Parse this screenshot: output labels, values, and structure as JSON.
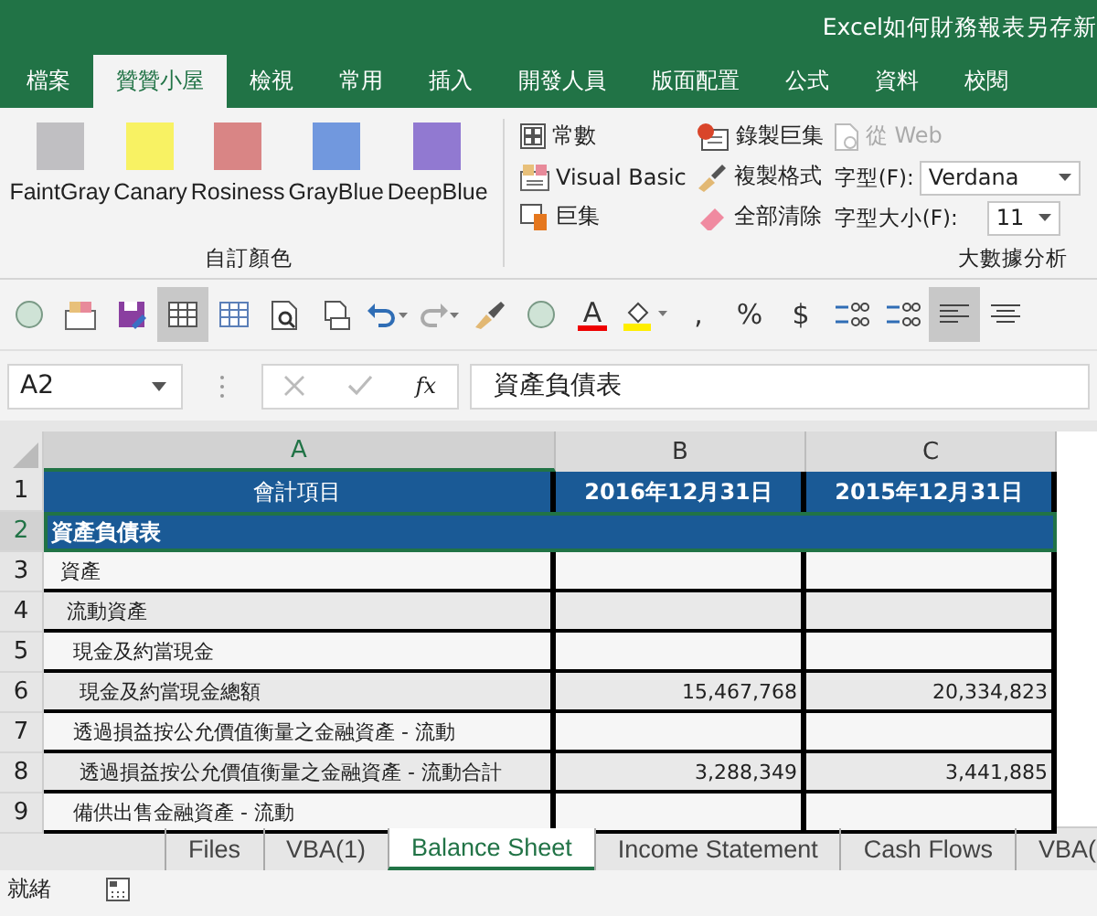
{
  "window": {
    "title": "Excel如何財務報表另存新"
  },
  "menu_tabs": [
    {
      "label": "檔案",
      "selected": false
    },
    {
      "label": "贊贊小屋",
      "selected": true
    },
    {
      "label": "檢視",
      "selected": false
    },
    {
      "label": "常用",
      "selected": false
    },
    {
      "label": "插入",
      "selected": false
    },
    {
      "label": "開發人員",
      "selected": false
    },
    {
      "label": "版面配置",
      "selected": false
    },
    {
      "label": "公式",
      "selected": false
    },
    {
      "label": "資料",
      "selected": false
    },
    {
      "label": "校閱",
      "selected": false
    }
  ],
  "ribbon": {
    "color_group": {
      "label": "自訂顏色",
      "swatches": [
        {
          "name": "FaintGray",
          "color": "#c0bfc2"
        },
        {
          "name": "Canary",
          "color": "#f8f263"
        },
        {
          "name": "Rosiness",
          "color": "#d98585"
        },
        {
          "name": "GrayBlue",
          "color": "#7198de"
        },
        {
          "name": "DeepBlue",
          "color": "#9179d1"
        }
      ]
    },
    "dev_group": {
      "label": "大數據分析",
      "buttons": [
        {
          "kind": "constants",
          "label": "常數",
          "disabled": false
        },
        {
          "kind": "vb",
          "label": "Visual Basic",
          "disabled": false
        },
        {
          "kind": "macro",
          "label": "巨集",
          "disabled": false
        },
        {
          "kind": "record",
          "label": "錄製巨集",
          "disabled": false
        },
        {
          "kind": "brush",
          "label": "複製格式",
          "disabled": false
        },
        {
          "kind": "eraser",
          "label": "全部清除",
          "disabled": false
        },
        {
          "kind": "web",
          "label": "從 Web",
          "disabled": true
        }
      ],
      "font": {
        "label": "字型(F):",
        "value": "Verdana"
      },
      "font_size": {
        "label": "字型大小(F):",
        "value": "11"
      }
    }
  },
  "quick_toolbar": [
    {
      "kind": "circle",
      "selected": false
    },
    {
      "kind": "paste",
      "selected": false
    },
    {
      "kind": "save",
      "selected": false
    },
    {
      "kind": "grid",
      "selected": true
    },
    {
      "kind": "grid2",
      "selected": false
    },
    {
      "kind": "preview",
      "selected": false
    },
    {
      "kind": "print",
      "selected": false
    },
    {
      "kind": "undo",
      "selected": false
    },
    {
      "kind": "redo",
      "selected": false
    },
    {
      "kind": "brush",
      "selected": false
    },
    {
      "kind": "circle",
      "selected": false
    },
    {
      "kind": "fontcolor",
      "label": "A",
      "selected": false
    },
    {
      "kind": "fill",
      "selected": false
    },
    {
      "kind": "glyph",
      "label": ",",
      "selected": false
    },
    {
      "kind": "glyph",
      "label": "%",
      "selected": false
    },
    {
      "kind": "glyph",
      "label": "$",
      "selected": false
    },
    {
      "kind": "incdec",
      "selected": false
    },
    {
      "kind": "decdec",
      "selected": false
    },
    {
      "kind": "alignleft",
      "selected": true
    },
    {
      "kind": "center",
      "selected": false
    }
  ],
  "formula_bar": {
    "name_box": "A2",
    "fx": "fx",
    "value": "資產負債表"
  },
  "columns": [
    {
      "label": "A",
      "selected": true
    },
    {
      "label": "B",
      "selected": false
    },
    {
      "label": "C",
      "selected": false
    }
  ],
  "rows": [
    {
      "number": "1",
      "kind": "header",
      "selected": false,
      "cells": [
        "會計項目",
        "2016年12月31日",
        "2015年12月31日"
      ]
    },
    {
      "number": "2",
      "kind": "title",
      "selected": true,
      "cells": [
        "資產負債表"
      ]
    },
    {
      "number": "3",
      "kind": "item",
      "selected": false,
      "cells": [
        "  資產",
        "",
        ""
      ]
    },
    {
      "number": "4",
      "kind": "item",
      "selected": false,
      "cells": [
        "   流動資產",
        "",
        ""
      ]
    },
    {
      "number": "5",
      "kind": "item",
      "selected": false,
      "cells": [
        "    現金及約當現金",
        "",
        ""
      ]
    },
    {
      "number": "6",
      "kind": "item",
      "selected": false,
      "cells": [
        "     現金及約當現金總額",
        "15,467,768",
        "20,334,823"
      ]
    },
    {
      "number": "7",
      "kind": "item",
      "selected": false,
      "cells": [
        "    透過損益按公允價值衡量之金融資產 - 流動",
        "",
        ""
      ]
    },
    {
      "number": "8",
      "kind": "item",
      "selected": false,
      "cells": [
        "     透過損益按公允價值衡量之金融資產 - 流動合計",
        "3,288,349",
        "3,441,885"
      ]
    },
    {
      "number": "9",
      "kind": "item",
      "selected": false,
      "cells": [
        "    備供出售金融資產 - 流動",
        "",
        ""
      ]
    }
  ],
  "sheet_tabs": [
    {
      "label": "Files",
      "selected": false
    },
    {
      "label": "VBA(1)",
      "selected": false
    },
    {
      "label": "Balance Sheet",
      "selected": true
    },
    {
      "label": "Income Statement",
      "selected": false
    },
    {
      "label": "Cash Flows",
      "selected": false
    },
    {
      "label": "VBA(",
      "selected": false
    }
  ],
  "status_bar": {
    "text": "就緒"
  }
}
